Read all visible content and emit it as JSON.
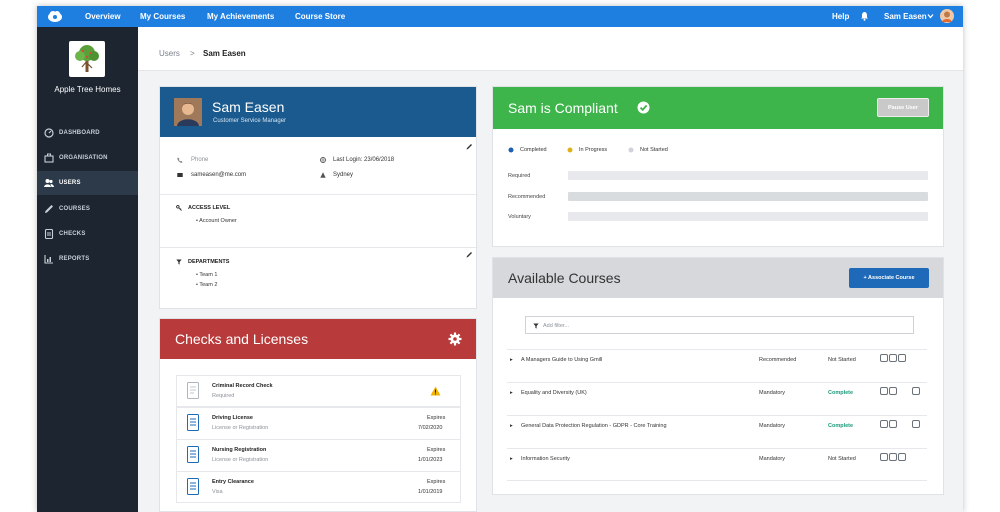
{
  "topbar": {
    "nav": [
      "Overview",
      "My Courses",
      "My Achievements",
      "Course Store"
    ],
    "help": "Help",
    "user": "Sam Easen",
    "bell_icon": "bell-icon",
    "color": "#1f7fe0"
  },
  "sidebar": {
    "brand": "Apple Tree Homes",
    "items": [
      {
        "label": "DASHBOARD",
        "icon": "dashboard-icon"
      },
      {
        "label": "ORGANISATION",
        "icon": "organisation-icon"
      },
      {
        "label": "USERS",
        "icon": "users-icon"
      },
      {
        "label": "COURSES",
        "icon": "pencil-icon"
      },
      {
        "label": "CHECKS",
        "icon": "checks-icon"
      },
      {
        "label": "REPORTS",
        "icon": "reports-icon"
      }
    ],
    "active": "USERS"
  },
  "breadcrumb": {
    "parent": "Users",
    "separator": ">",
    "current": "Sam Easen"
  },
  "profile": {
    "name": "Sam Easen",
    "role": "Customer Service Manager",
    "phone": "Phone",
    "email": "sameasen@me.com",
    "last_login": "Last Login: 23/06/2018",
    "location": "Sydney",
    "access_level_title": "ACCESS LEVEL",
    "access_level": "Account Owner",
    "departments_title": "DEPARTMENTS",
    "departments": [
      "Team 1",
      "Team 2"
    ],
    "header_color": "#1a5a8f"
  },
  "checks": {
    "title": "Checks and Licenses",
    "header_color": "#b83a3a",
    "items": [
      {
        "name": "Criminal Record Check",
        "sub": "Required",
        "expires_label": "",
        "expires": "",
        "warning": true
      },
      {
        "name": "Driving License",
        "sub": "License or Registration",
        "expires_label": "Expires",
        "expires": "7/02/2020",
        "warning": false
      },
      {
        "name": "Nursing Registration",
        "sub": "License or Registration",
        "expires_label": "Expires",
        "expires": "1/01/2023",
        "warning": false
      },
      {
        "name": "Entry Clearance",
        "sub": "Visa",
        "expires_label": "Expires",
        "expires": "1/01/2019",
        "warning": false
      }
    ]
  },
  "compliance": {
    "title": "Sam is Compliant",
    "header_color": "#3db54a",
    "button": "Pause User",
    "legend": [
      {
        "label": "Completed",
        "color": "#1f5fb0"
      },
      {
        "label": "In Progress",
        "color": "#e0b21a"
      },
      {
        "label": "Not Started",
        "color": "#cfd3d8"
      }
    ],
    "rows": [
      {
        "label": "Required"
      },
      {
        "label": "Recommended"
      },
      {
        "label": "Voluntary"
      }
    ]
  },
  "courses": {
    "title": "Available Courses",
    "button": "+ Associate Course",
    "filter_placeholder": "Add filter...",
    "items": [
      {
        "name": "A Managers Guide to Using Gmill",
        "requirement": "Recommended",
        "status": "Not Started",
        "status_color": "#333333"
      },
      {
        "name": "Equality and Diversity (UK)",
        "requirement": "Mandatory",
        "status": "Complete",
        "status_color": "#1a9a7a"
      },
      {
        "name": "General Data Protection Regulation - GDPR - Core Training",
        "requirement": "Mandatory",
        "status": "Complete",
        "status_color": "#1a9a7a"
      },
      {
        "name": "Information Security",
        "requirement": "Mandatory",
        "status": "Not Started",
        "status_color": "#333333"
      }
    ]
  }
}
